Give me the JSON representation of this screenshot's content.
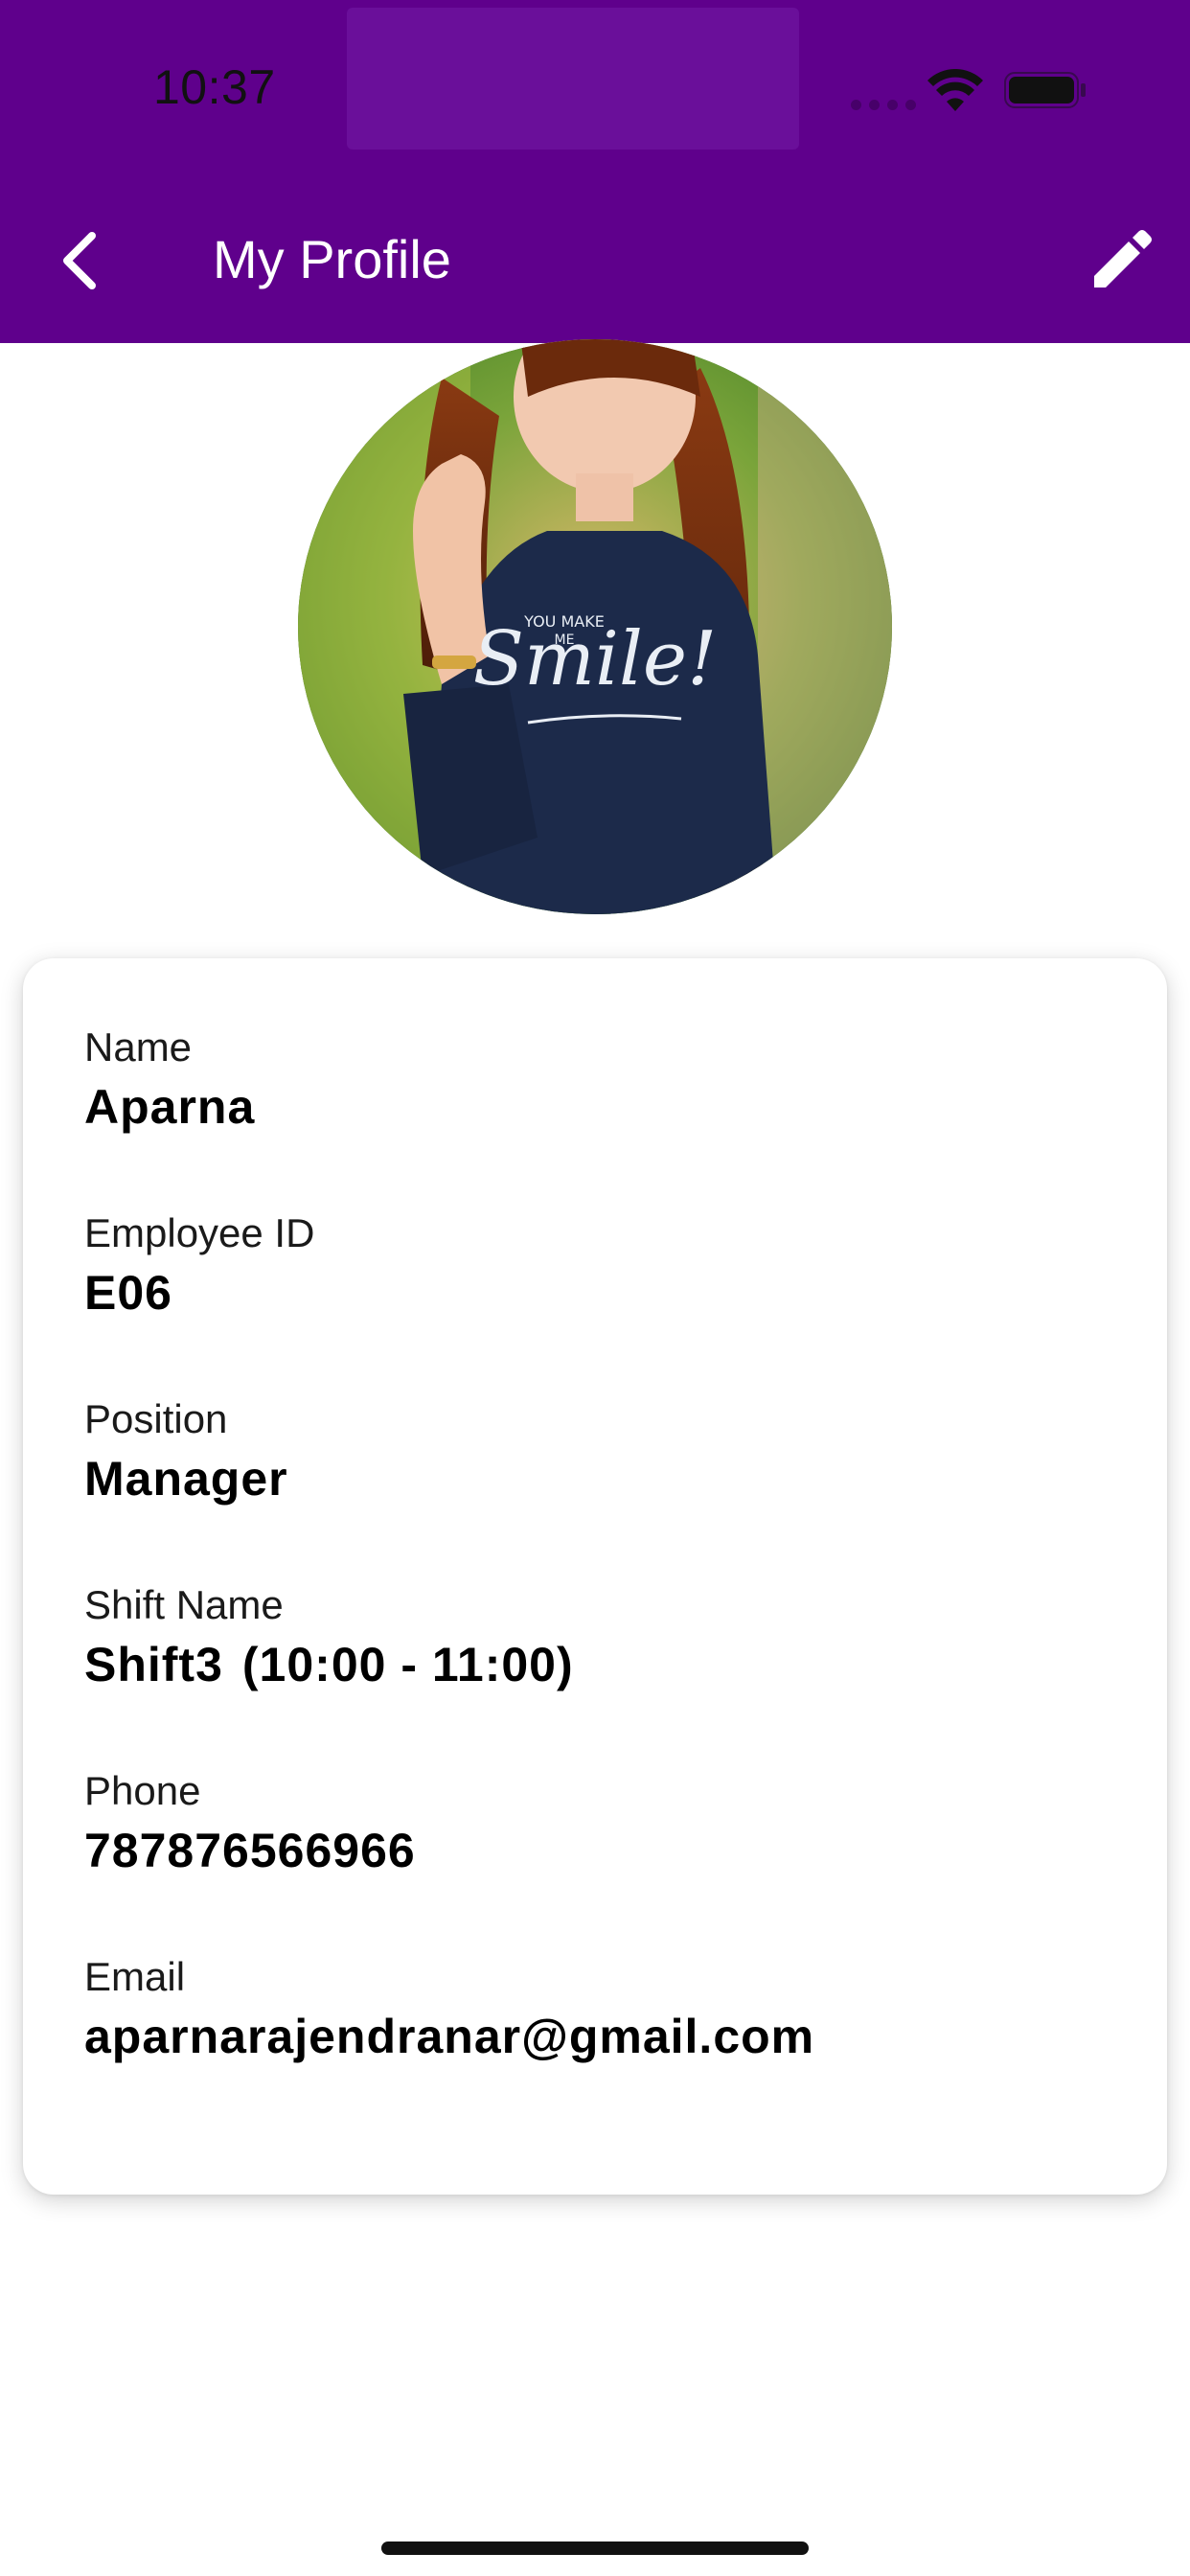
{
  "status_bar": {
    "time": "10:37"
  },
  "header": {
    "title": "My Profile",
    "background_color": "#5f008c",
    "back_icon": "chevron-left-icon",
    "edit_icon": "pencil-icon"
  },
  "profile": {
    "avatar_icon": "profile-photo",
    "fields": [
      {
        "label": "Name",
        "value": "Aparna"
      },
      {
        "label": "Employee ID",
        "value": "E06"
      },
      {
        "label": "Position",
        "value": "Manager"
      },
      {
        "label": "Shift Name",
        "value": "Shift3",
        "value_extra": "(10:00 - 11:00)"
      },
      {
        "label": "Phone",
        "value": "787876566966"
      },
      {
        "label": "Email",
        "value": "aparnarajendranar@gmail.com"
      }
    ]
  }
}
